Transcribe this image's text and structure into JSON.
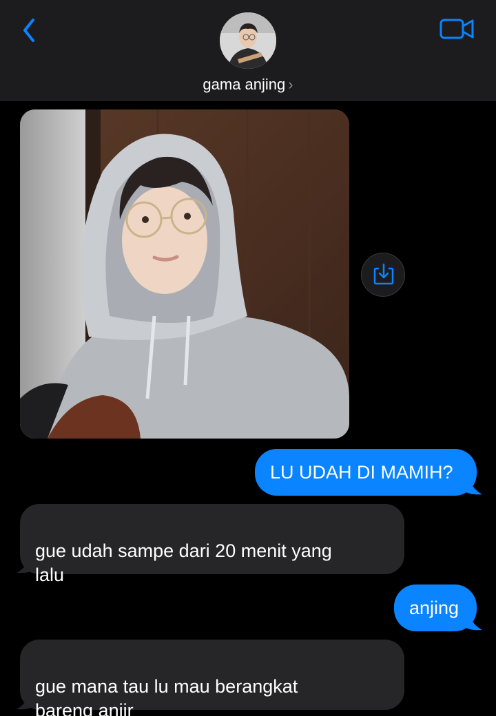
{
  "header": {
    "contact_name": "gama anjing",
    "chevron": "›",
    "back_icon": "chevron-left-icon",
    "video_icon": "video-camera-icon",
    "accent_color": "#0a84ff"
  },
  "conversation": {
    "messages": [
      {
        "direction": "incoming",
        "type": "image"
      },
      {
        "direction": "outgoing",
        "text": "LU UDAH DI MAMIH?"
      },
      {
        "direction": "incoming",
        "text": "gue udah sampe dari 20 menit yang\nlalu"
      },
      {
        "direction": "outgoing",
        "text": "anjing"
      },
      {
        "direction": "incoming",
        "text": "gue mana tau lu mau berangkat\nbareng anjir"
      }
    ],
    "save_icon": "save-to-photos-icon"
  },
  "colors": {
    "outgoing_bubble": "#0a84ff",
    "incoming_bubble": "#262628",
    "background": "#000000",
    "header_background": "#1c1c1e"
  }
}
